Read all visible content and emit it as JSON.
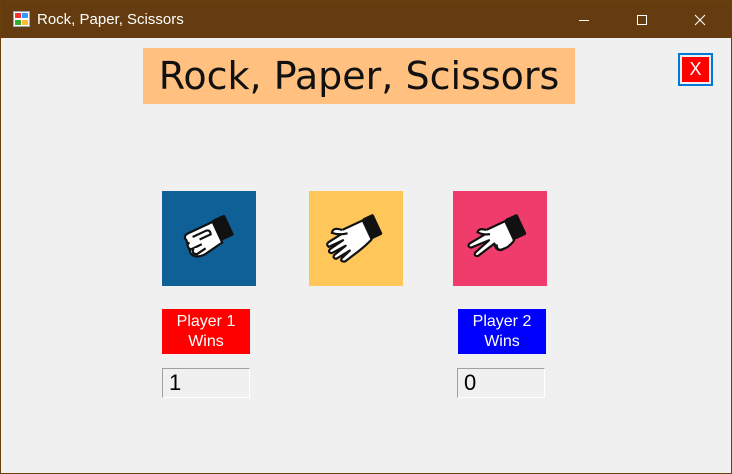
{
  "window": {
    "title": "Rock, Paper, Scissors",
    "minimize_label": "Minimize",
    "maximize_label": "Maximize",
    "close_label": "Close"
  },
  "game": {
    "heading": "Rock, Paper, Scissors",
    "exit_button_label": "X"
  },
  "choices": [
    {
      "name": "rock",
      "icon": "rock-hand-icon",
      "color": "#0f6096"
    },
    {
      "name": "paper",
      "icon": "paper-hand-icon",
      "color": "#ffc65a"
    },
    {
      "name": "scissors",
      "icon": "scissors-hand-icon",
      "color": "#f03c6c"
    }
  ],
  "player1": {
    "label": "Player 1\nWins",
    "score": "1",
    "color": "#ff0000"
  },
  "player2": {
    "label": "Player 2\nWins",
    "score": "0",
    "color": "#0000ff"
  },
  "colors": {
    "titlebar": "#653c0f",
    "heading_bg": "#ffc080",
    "exit_bg": "#ff0000"
  }
}
